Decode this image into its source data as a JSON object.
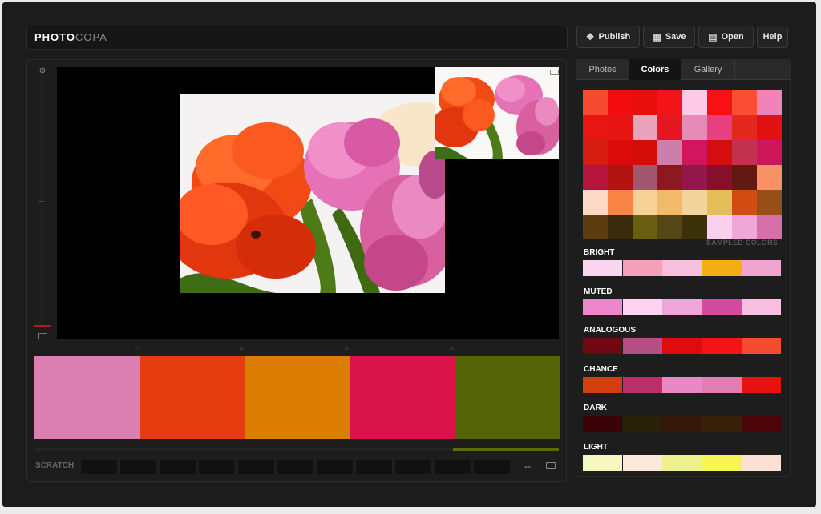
{
  "app": {
    "logo_a": "PHOTO",
    "logo_b": "COPA"
  },
  "toolbar": [
    {
      "label": "Publish",
      "icon": "publish-icon",
      "glyph": "❖"
    },
    {
      "label": "Save",
      "icon": "save-icon",
      "glyph": "▦"
    },
    {
      "label": "Open",
      "icon": "open-icon",
      "glyph": "▤"
    },
    {
      "label": "Help",
      "icon": "",
      "glyph": ""
    }
  ],
  "tabs": [
    {
      "label": "Photos",
      "active": false
    },
    {
      "label": "Colors",
      "active": true
    },
    {
      "label": "Gallery",
      "active": false
    }
  ],
  "sampled_label": "SAMPLED COLORS",
  "sampled_grid": [
    [
      "#f64a31",
      "#f20c0e",
      "#ea0d0d",
      "#f31419",
      "#fcc9e6",
      "#f81014",
      "#f94f35",
      "#f183b9"
    ],
    [
      "#e81612",
      "#e61513",
      "#eaa3bd",
      "#e41621",
      "#e88ab7",
      "#e73f80",
      "#e5281d",
      "#e01212"
    ],
    [
      "#d61d12",
      "#dd0c0c",
      "#d40d0b",
      "#cd7fa9",
      "#d0175e",
      "#d40d0e",
      "#c2314f",
      "#cc175a"
    ],
    [
      "#b6143d",
      "#b41410",
      "#a2576f",
      "#8c1920",
      "#93174b",
      "#86102c",
      "#631810",
      "#f89166"
    ],
    [
      "#fed8c7",
      "#f98344",
      "#f6d298",
      "#f2bb6a",
      "#f2d39a",
      "#e3be58",
      "#d04c10",
      "#984e17"
    ],
    [
      "#5e3c0f",
      "#3a2a0c",
      "#6a5e10",
      "#554617",
      "#3c3109",
      "#fad0ee",
      "#f1a6d8",
      "#d66faa"
    ]
  ],
  "harmonies": [
    {
      "name": "BRIGHT",
      "colors": [
        "#fbd6f1",
        "#f2a1b8",
        "#f9bfdf",
        "#f3ae14",
        "#f0a5d1"
      ]
    },
    {
      "name": "MUTED",
      "colors": [
        "#ee86cc",
        "#fcd3f0",
        "#f0a5da",
        "#d34b9d",
        "#f8bfe2"
      ]
    },
    {
      "name": "ANALOGOUS",
      "colors": [
        "#6e0911",
        "#b44e87",
        "#de0d0c",
        "#f51415",
        "#f74b2f"
      ]
    },
    {
      "name": "CHANCE",
      "colors": [
        "#d43d0e",
        "#b9306d",
        "#e689c4",
        "#e17db1",
        "#e5120f"
      ]
    },
    {
      "name": "DARK",
      "colors": [
        "#3a0407",
        "#2a2208",
        "#35170a",
        "#392109",
        "#4c060b"
      ]
    },
    {
      "name": "LIGHT",
      "colors": [
        "#f5f7c1",
        "#fde9d7",
        "#eef28a",
        "#f6f555",
        "#fde0d4"
      ]
    }
  ],
  "palette": [
    "#db7fb3",
    "#e43e10",
    "#dc7e03",
    "#d8134a",
    "#546306"
  ],
  "palette_ticks": [
    "↕↕↕",
    "↕↕↕",
    "↕↕↕",
    "↕↕↕"
  ],
  "scratch": {
    "label": "SCRATCH",
    "slots": 11
  },
  "colors": {
    "scroll_accent": "#5b6b0f",
    "zoom_marker": "#c0141a"
  }
}
